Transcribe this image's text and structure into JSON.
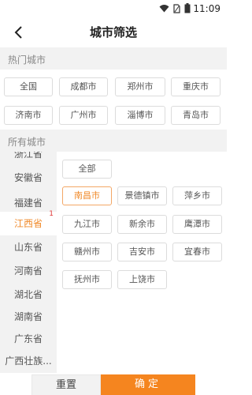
{
  "status_bar": {
    "time": "11:09",
    "icons": [
      "wifi-icon",
      "sim-no-signal-icon",
      "battery-icon"
    ]
  },
  "header": {
    "title": "城市筛选",
    "back_icon": "chevron-left-icon"
  },
  "hot_cities": {
    "title": "热门城市",
    "items": [
      "全国",
      "成都市",
      "郑州市",
      "重庆市",
      "济南市",
      "广州市",
      "淄博市",
      "青岛市"
    ]
  },
  "all_cities": {
    "title": "所有城市",
    "provinces": [
      "浙江省",
      "安徽省",
      "福建省",
      "江西省",
      "山东省",
      "河南省",
      "湖北省",
      "湖南省",
      "广东省",
      "广西壮族..."
    ],
    "active_province": "江西省",
    "active_badge": "1",
    "all_button": "全部",
    "cities": [
      "南昌市",
      "景德镇市",
      "萍乡市",
      "九江市",
      "新余市",
      "鹰潭市",
      "赣州市",
      "吉安市",
      "宜春市",
      "抚州市",
      "上饶市"
    ],
    "selected_city": "南昌市"
  },
  "footer": {
    "reset_label": "重置",
    "confirm_label": "确定"
  },
  "colors": {
    "accent": "#f5851f",
    "section_bg": "#f2f2f2"
  }
}
